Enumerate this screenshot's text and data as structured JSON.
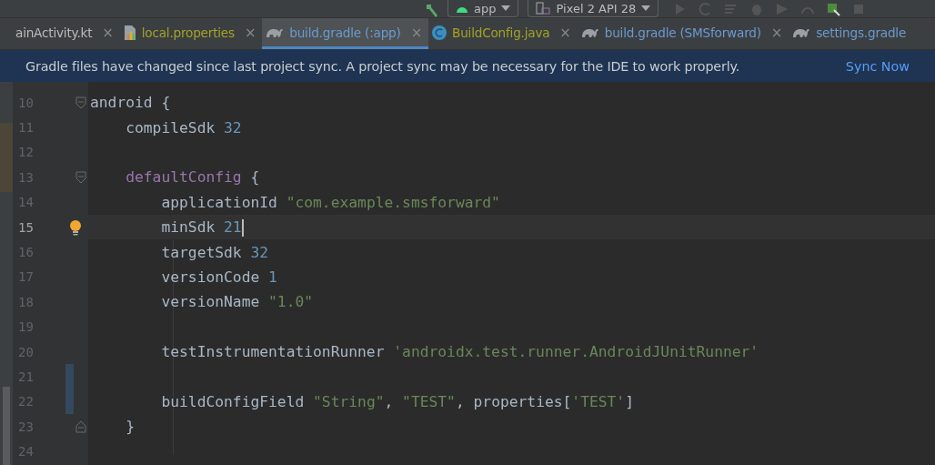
{
  "toolbar": {
    "config": "app",
    "device": "Pixel 2 API 28"
  },
  "tabs": [
    {
      "label": "ainActivity.kt",
      "kind": "kotlin",
      "selected": false,
      "color": "#bbbbbb",
      "close": "×"
    },
    {
      "label": "local.properties",
      "kind": "properties",
      "selected": false,
      "color": "#a3a325",
      "close": "×"
    },
    {
      "label": "build.gradle (:app)",
      "kind": "gradle",
      "selected": true,
      "color": "#6a9ad2",
      "close": "×"
    },
    {
      "label": "BuildConfig.java",
      "kind": "java",
      "selected": false,
      "color": "#a3a325",
      "close": "×"
    },
    {
      "label": "build.gradle (SMSforward)",
      "kind": "gradle",
      "selected": false,
      "color": "#6a9ad2",
      "close": "×"
    },
    {
      "label": "settings.gradle",
      "kind": "gradle",
      "selected": false,
      "color": "#6a9ad2"
    }
  ],
  "banner": {
    "message": "Gradle files have changed since last project sync. A project sync may be necessary for the IDE to work properly.",
    "action": "Sync Now"
  },
  "editor": {
    "lines": [
      {
        "number": "10",
        "fold_start": true,
        "tokens": [
          {
            "kind": "plain",
            "text": "android {"
          }
        ]
      },
      {
        "number": "11",
        "tokens": [
          {
            "kind": "plain",
            "text": "    compileSdk "
          },
          {
            "kind": "number",
            "text": "32"
          }
        ]
      },
      {
        "number": "12"
      },
      {
        "number": "13",
        "fold_start": true,
        "tokens": [
          {
            "kind": "keyword",
            "text": "    defaultConfig"
          },
          {
            "kind": "plain",
            "text": " {"
          }
        ]
      },
      {
        "number": "14",
        "tokens": [
          {
            "kind": "plain",
            "text": "        applicationId "
          },
          {
            "kind": "string",
            "text": "\"com.example.smsforward\""
          }
        ]
      },
      {
        "number": "15",
        "current": true,
        "bulb": true,
        "tokens": [
          {
            "kind": "plain",
            "text": "        minSdk "
          },
          {
            "kind": "number",
            "text": "21"
          }
        ]
      },
      {
        "number": "16",
        "tokens": [
          {
            "kind": "plain",
            "text": "        targetSdk "
          },
          {
            "kind": "number",
            "text": "32"
          }
        ]
      },
      {
        "number": "17",
        "tokens": [
          {
            "kind": "plain",
            "text": "        versionCode "
          },
          {
            "kind": "number",
            "text": "1"
          }
        ]
      },
      {
        "number": "18",
        "tokens": [
          {
            "kind": "plain",
            "text": "        versionName "
          },
          {
            "kind": "string",
            "text": "\"1.0\""
          }
        ]
      },
      {
        "number": "19"
      },
      {
        "number": "20",
        "tokens": [
          {
            "kind": "plain",
            "text": "        testInstrumentationRunner "
          },
          {
            "kind": "string",
            "text": "'androidx.test.runner.AndroidJUnitRunner'"
          }
        ]
      },
      {
        "number": "21",
        "changed": true
      },
      {
        "number": "22",
        "changed": true,
        "tokens": [
          {
            "kind": "plain",
            "text": "        buildConfigField "
          },
          {
            "kind": "string",
            "text": "\"String\""
          },
          {
            "kind": "plain",
            "text": ", "
          },
          {
            "kind": "string",
            "text": "\"TEST\""
          },
          {
            "kind": "plain",
            "text": ", properties["
          },
          {
            "kind": "string",
            "text": "'TEST'"
          },
          {
            "kind": "plain",
            "text": "]"
          }
        ]
      },
      {
        "number": "23",
        "fold_end": true,
        "tokens": [
          {
            "kind": "plain",
            "text": "    }"
          }
        ]
      },
      {
        "number": "24"
      }
    ]
  }
}
